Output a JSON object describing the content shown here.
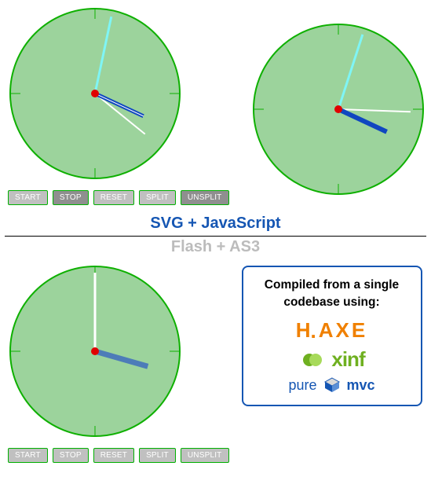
{
  "sections": {
    "top_label": "SVG + JavaScript",
    "bottom_label": "Flash + AS3"
  },
  "top": {
    "buttons": {
      "start": "START",
      "stop": "STOP",
      "reset": "RESET",
      "split": "SPLIT",
      "unsplit": "UNSPLIT"
    },
    "clock_left": {
      "long_hand_angle_deg": 12,
      "blue_hand_angle_deg": 115,
      "white_hand_angle_deg": 129
    },
    "clock_right": {
      "long_hand_angle_deg": 18,
      "blue_hand_angle_deg": 115,
      "white_hand_angle_deg": 92
    }
  },
  "bottom": {
    "buttons": {
      "start": "START",
      "stop": "STOP",
      "reset": "RESET",
      "split": "SPLIT",
      "unsplit": "UNSPLIT"
    },
    "clock_left": {
      "long_hand_angle_deg": 0,
      "blue_hand_angle_deg": 106,
      "white_hand_angle_deg": 0
    }
  },
  "infobox": {
    "title_line1": "Compiled from a single",
    "title_line2": "codebase using:",
    "logos": {
      "haxe": "HAXE",
      "xinf": "xinf",
      "pure": "pure",
      "mvc": "mvc"
    }
  },
  "colors": {
    "clock_fill": "#9cd39c",
    "clock_stroke": "#0eb000",
    "accent_blue": "#1556b3",
    "haxe_orange": "#f08000",
    "xinf_green": "#6fb020"
  }
}
